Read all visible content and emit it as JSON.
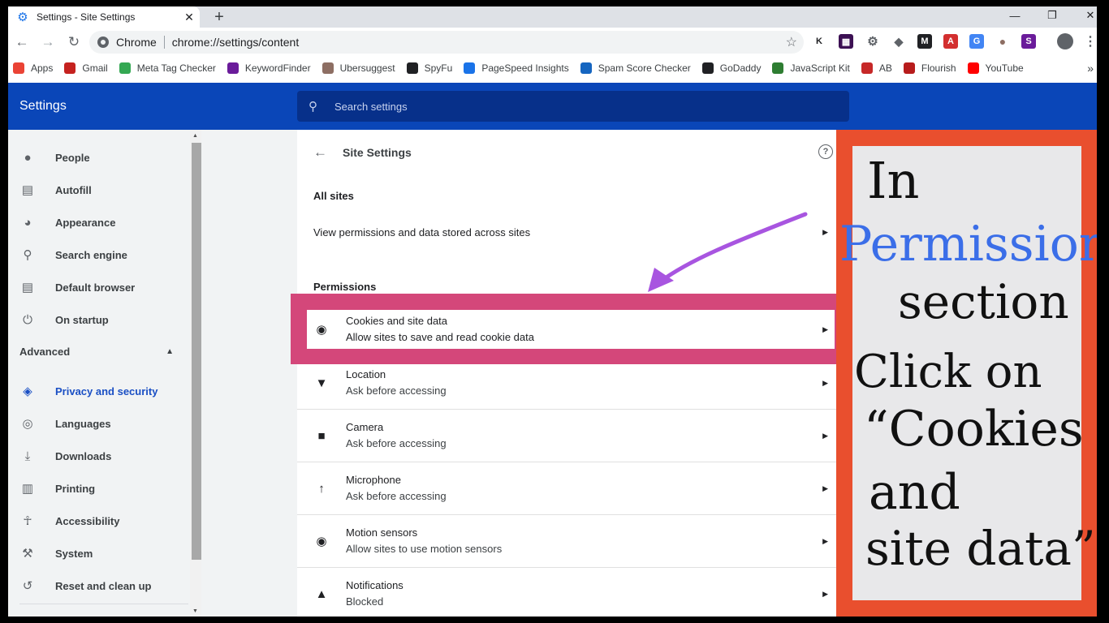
{
  "browser": {
    "tab_title": "Settings - Site Settings",
    "omnibox_chip": "Chrome",
    "url": "chrome://settings/content"
  },
  "bookmarks": [
    {
      "label": "Apps",
      "color": "#ea4335"
    },
    {
      "label": "Gmail",
      "color": "#c5221f"
    },
    {
      "label": "Meta Tag Checker",
      "color": "#34a853"
    },
    {
      "label": "KeywordFinder",
      "color": "#6a1b9a"
    },
    {
      "label": "Ubersuggest",
      "color": "#8d6e63"
    },
    {
      "label": "SpyFu",
      "color": "#202124"
    },
    {
      "label": "PageSpeed Insights",
      "color": "#1a73e8"
    },
    {
      "label": "Spam Score Checker",
      "color": "#1565c0"
    },
    {
      "label": "GoDaddy",
      "color": "#202124"
    },
    {
      "label": "JavaScript Kit",
      "color": "#2e7d32"
    },
    {
      "label": "AB",
      "color": "#c62828"
    },
    {
      "label": "Flourish",
      "color": "#b71c1c"
    },
    {
      "label": "YouTube",
      "color": "#ff0000"
    }
  ],
  "settings": {
    "title": "Settings",
    "search_placeholder": "Search settings"
  },
  "sidebar": {
    "items": [
      {
        "label": "People",
        "icon": "person-icon"
      },
      {
        "label": "Autofill",
        "icon": "clipboard-icon"
      },
      {
        "label": "Appearance",
        "icon": "palette-icon"
      },
      {
        "label": "Search engine",
        "icon": "search-icon"
      },
      {
        "label": "Default browser",
        "icon": "browser-icon"
      },
      {
        "label": "On startup",
        "icon": "power-icon"
      }
    ],
    "advanced_label": "Advanced",
    "advanced_items": [
      {
        "label": "Privacy and security",
        "icon": "shield-icon",
        "active": true
      },
      {
        "label": "Languages",
        "icon": "globe-icon"
      },
      {
        "label": "Downloads",
        "icon": "download-icon"
      },
      {
        "label": "Printing",
        "icon": "printer-icon"
      },
      {
        "label": "Accessibility",
        "icon": "accessibility-icon"
      },
      {
        "label": "System",
        "icon": "wrench-icon"
      },
      {
        "label": "Reset and clean up",
        "icon": "history-icon"
      }
    ]
  },
  "main": {
    "title": "Site Settings",
    "all_sites_label": "All sites",
    "all_sites_row": "View permissions and data stored across sites",
    "permissions_label": "Permissions",
    "permissions": [
      {
        "title": "Cookies and site data",
        "sub": "Allow sites to save and read cookie data",
        "icon": "cookie-icon"
      },
      {
        "title": "Location",
        "sub": "Ask before accessing",
        "icon": "location-icon"
      },
      {
        "title": "Camera",
        "sub": "Ask before accessing",
        "icon": "camera-icon"
      },
      {
        "title": "Microphone",
        "sub": "Ask before accessing",
        "icon": "microphone-icon"
      },
      {
        "title": "Motion sensors",
        "sub": "Allow sites to use motion sensors",
        "icon": "motion-sensor-icon"
      },
      {
        "title": "Notifications",
        "sub": "Blocked",
        "icon": "bell-icon"
      }
    ]
  },
  "annotation": {
    "line1": "In",
    "line2": "Permission",
    "line3": "section",
    "line4": "Click on",
    "line5": "“Cookies",
    "line6": "and",
    "line7": "site data”",
    "accent_color": "#3b6ee8",
    "frame_color": "#e94f2e",
    "highlight_color": "#d4477a",
    "arrow_color": "#a855e0"
  }
}
